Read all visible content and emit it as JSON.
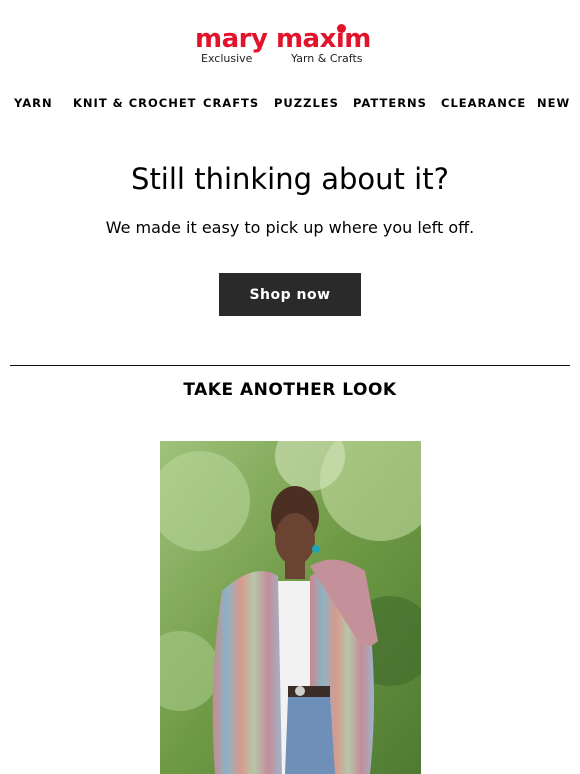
{
  "brand": {
    "logo_text": "mary maxim",
    "tagline_left": "Exclusive",
    "tagline_right": "Yarn & Crafts",
    "color": "#e2132a"
  },
  "nav": {
    "items": [
      {
        "label": "YARN"
      },
      {
        "label": "KNIT & CROCHET"
      },
      {
        "label": "CRAFTS"
      },
      {
        "label": "PUZZLES"
      },
      {
        "label": "PATTERNS"
      },
      {
        "label": "CLEARANCE"
      },
      {
        "label": "NEW"
      }
    ]
  },
  "hero": {
    "headline": "Still thinking about it?",
    "subline": "We made it easy to pick up where you left off.",
    "cta_label": "Shop now"
  },
  "section": {
    "title": "TAKE ANOTHER LOOK"
  },
  "product": {
    "image_alt": "Woman wearing a multicolor knitted cardigan outdoors"
  }
}
